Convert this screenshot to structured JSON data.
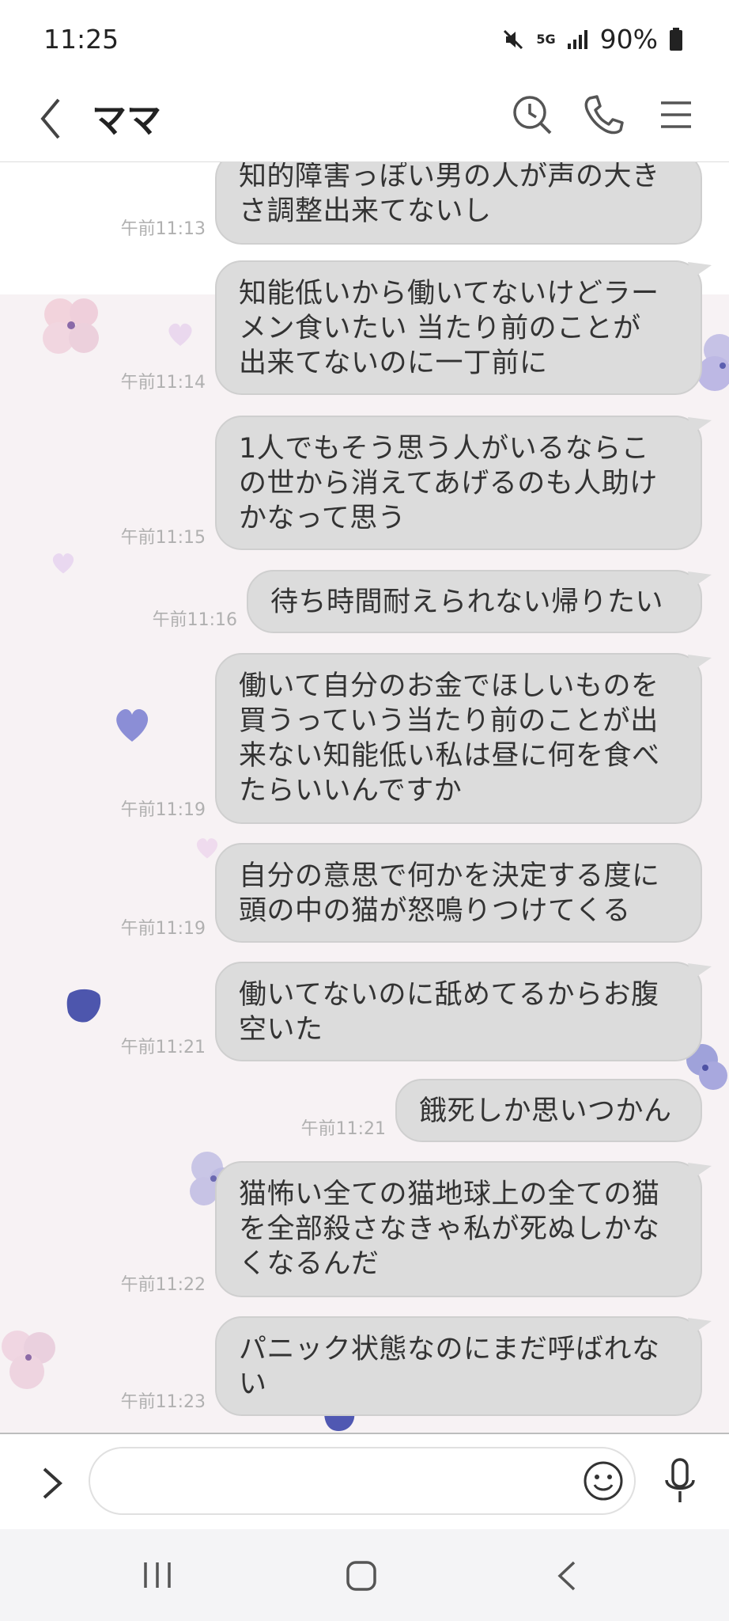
{
  "status_bar": {
    "time": "11:25",
    "network": "5G",
    "battery": "90%"
  },
  "header": {
    "title": "ママ",
    "icons": [
      "back-chevron-icon",
      "search-clock-icon",
      "phone-icon",
      "menu-icon"
    ]
  },
  "messages": [
    {
      "text": "知的障害っぽい男の人が声の大き\nさ調整出来てないし",
      "time": "午前11:13"
    },
    {
      "text": "知能低いから働いてないけどラー\nメン食いたい 当たり前のことが\n出来てないのに一丁前に",
      "time": "午前11:14"
    },
    {
      "text": "1人でもそう思う人がいるならこ\nの世から消えてあげるのも人助け\nかなって思う",
      "time": "午前11:15"
    },
    {
      "text": "待ち時間耐えられない帰りたい",
      "time": "午前11:16"
    },
    {
      "text": "働いて自分のお金でほしいものを\n買うっていう当たり前のことが出\n来ない知能低い私は昼に何を食べ\nたらいいんですか",
      "time": "午前11:19"
    },
    {
      "text": "自分の意思で何かを決定する度に\n頭の中の猫が怒鳴りつけてくる",
      "time": "午前11:19"
    },
    {
      "text": "働いてないのに舐めてるからお腹\n空いた",
      "time": "午前11:21"
    },
    {
      "text": "餓死しか思いつかん",
      "time": "午前11:21"
    },
    {
      "text": "猫怖い全ての猫地球上の全ての猫\nを全部殺さなきゃ私が死ぬしかな\nくなるんだ",
      "time": "午前11:22"
    },
    {
      "text": "パニック状態なのにまだ呼ばれな\nい",
      "time": "午前11:23"
    }
  ],
  "input_bar": {
    "placeholder": "",
    "icons": [
      "expand-chevron-icon",
      "emoji-icon",
      "microphone-icon"
    ]
  },
  "nav_bar": {
    "icons": [
      "recent-apps-icon",
      "home-icon",
      "back-icon"
    ]
  },
  "colors": {
    "bubble": "#dcdcdc",
    "chat_background": "#f7f2f4",
    "timestamp": "#b0b0b0"
  }
}
